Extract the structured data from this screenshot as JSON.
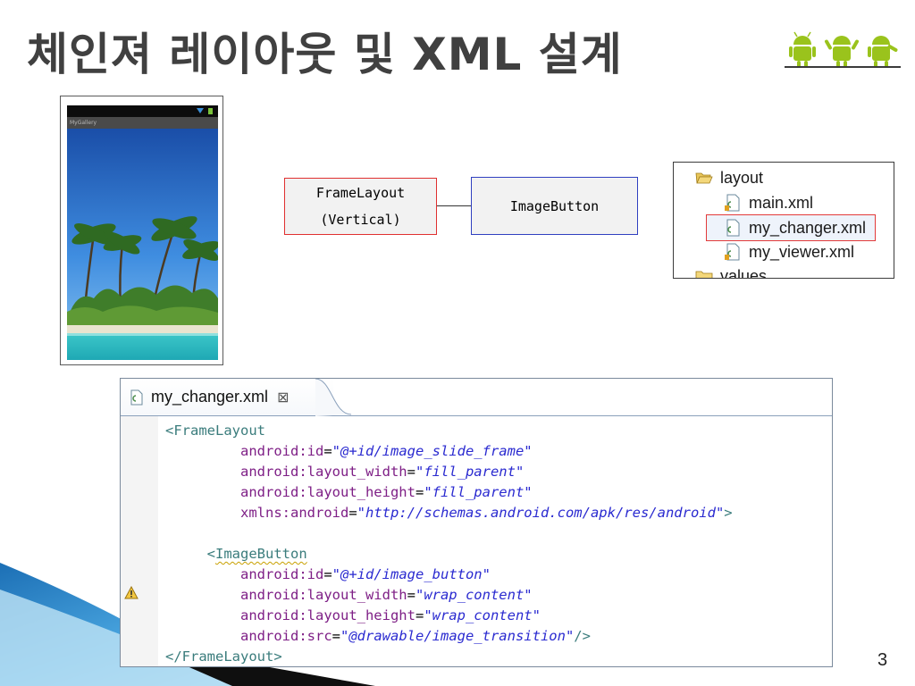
{
  "slide": {
    "title": "체인져 레이아웃 및 XML 설계",
    "page_number": "3",
    "accent_colors": {
      "android_green": "#9ac31c",
      "deco_blue": "#4a9cd8"
    },
    "decoration_icon": "android-robots-icon"
  },
  "phone": {
    "app_title": "MyGallery",
    "image": "tropical-beach-photo"
  },
  "diagram": {
    "frame_box": {
      "line1": "FrameLayout",
      "line2": "(Vertical)"
    },
    "image_box": {
      "label": "ImageButton"
    }
  },
  "tree": {
    "items": [
      {
        "label": "layout",
        "icon": "folder-open-icon"
      },
      {
        "label": "main.xml",
        "icon": "xml-file-icon"
      },
      {
        "label": "my_changer.xml",
        "icon": "xml-file-icon",
        "selected": true
      },
      {
        "label": "my_viewer.xml",
        "icon": "xml-file-icon"
      },
      {
        "label": "values",
        "icon": "folder-icon"
      }
    ]
  },
  "editor": {
    "tab_label": "my_changer.xml",
    "close_glyph": "⊠",
    "code": {
      "frame_open": "<FrameLayout",
      "frame_attrs": [
        {
          "name": "android:id",
          "value": "\"@+id/image_slide_frame\""
        },
        {
          "name": "android:layout_width",
          "value": "\"fill_parent\""
        },
        {
          "name": "android:layout_height",
          "value": "\"fill_parent\""
        },
        {
          "name": "xmlns:android",
          "value": "\"http://schemas.android.com/apk/res/android\"",
          "suffix": ">"
        }
      ],
      "button_open_bracket": "<",
      "button_open": "ImageButton",
      "button_attrs": [
        {
          "name": "android:id",
          "value": "\"@+id/image_button\""
        },
        {
          "name": "android:layout_width",
          "value": "\"wrap_content\""
        },
        {
          "name": "android:layout_height",
          "value": "\"wrap_content\""
        },
        {
          "name": "android:src",
          "value": "\"@drawable/image_transition\"",
          "suffix": "/>"
        }
      ],
      "frame_close": "</FrameLayout>"
    }
  }
}
